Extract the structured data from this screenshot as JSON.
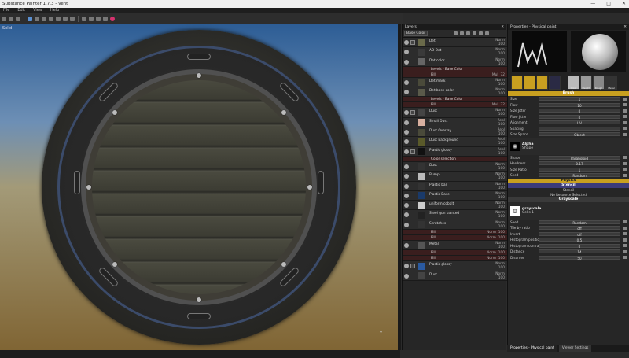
{
  "title": "Substance Painter 1.7.3 - Vent",
  "window_buttons": [
    "—",
    "□",
    "✕"
  ],
  "menu": [
    "File",
    "Edit",
    "View",
    "Help"
  ],
  "viewport": {
    "label": "Solid",
    "axis": "Y"
  },
  "layers": {
    "header": "Layers",
    "channel": "Base Color",
    "rows": [
      {
        "name": "Det",
        "blend": "Norm",
        "opacity": "100",
        "type": "group"
      },
      {
        "name": "AO Det",
        "blend": "Norm",
        "opacity": "100",
        "type": "layer"
      },
      {
        "name": "Det color",
        "blend": "Norm",
        "opacity": "100",
        "type": "layer"
      },
      {
        "name": "Levels - Base Color",
        "blend": "",
        "opacity": "",
        "type": "fx"
      },
      {
        "name": "Fill",
        "blend": "Mul",
        "opacity": "72",
        "type": "fx"
      },
      {
        "name": "Det mask",
        "blend": "Norm",
        "opacity": "100",
        "type": "layer"
      },
      {
        "name": "Det base color",
        "blend": "Norm",
        "opacity": "100",
        "type": "layer"
      },
      {
        "name": "Levels - Base Color",
        "blend": "",
        "opacity": "",
        "type": "fx"
      },
      {
        "name": "Fill",
        "blend": "Mul",
        "opacity": "72",
        "type": "fx"
      },
      {
        "name": "Dust",
        "blend": "Norm",
        "opacity": "100",
        "type": "group"
      },
      {
        "name": "Small Dust",
        "blend": "Repl",
        "opacity": "100",
        "type": "layer"
      },
      {
        "name": "Dust Overlay",
        "blend": "Repl",
        "opacity": "100",
        "type": "layer"
      },
      {
        "name": "Dust Background",
        "blend": "Repl",
        "opacity": "100",
        "type": "layer"
      },
      {
        "name": "Plastic glossy",
        "blend": "Repl",
        "opacity": "100",
        "type": "group"
      },
      {
        "name": "Color selection",
        "blend": "",
        "opacity": "",
        "type": "fx"
      },
      {
        "name": "Dust",
        "blend": "Norm",
        "opacity": "100",
        "type": "layer"
      },
      {
        "name": "Bump",
        "blend": "Norm",
        "opacity": "100",
        "type": "layer"
      },
      {
        "name": "Plastic bar",
        "blend": "Norm",
        "opacity": "100",
        "type": "layer"
      },
      {
        "name": "Plastic Base",
        "blend": "Norm",
        "opacity": "100",
        "type": "layer"
      },
      {
        "name": "uniform cobalt",
        "blend": "Norm",
        "opacity": "100",
        "type": "layer"
      },
      {
        "name": "Steel gun painted",
        "blend": "Norm",
        "opacity": "100",
        "type": "layer"
      },
      {
        "name": "Scratches",
        "blend": "Norm",
        "opacity": "100",
        "type": "layer"
      },
      {
        "name": "Fill",
        "blend": "Norm",
        "opacity": "100",
        "type": "fx"
      },
      {
        "name": "Fill",
        "blend": "Norm",
        "opacity": "100",
        "type": "fx"
      },
      {
        "name": "Metal",
        "blend": "Norm",
        "opacity": "100",
        "type": "layer"
      },
      {
        "name": "Fill",
        "blend": "Norm",
        "opacity": "100",
        "type": "fx"
      },
      {
        "name": "Fill",
        "blend": "Norm",
        "opacity": "100",
        "type": "fx"
      },
      {
        "name": "Plastic glossy",
        "blend": "Norm",
        "opacity": "100",
        "type": "group"
      },
      {
        "name": "Dust",
        "blend": "Norm",
        "opacity": "100",
        "type": "layer"
      }
    ]
  },
  "properties": {
    "header": "Properties - Physical paint",
    "channels": [
      "Color",
      "Height",
      "Rough",
      "Metal"
    ],
    "brush_title": "Brush",
    "brush": [
      {
        "label": "Size",
        "value": "1"
      },
      {
        "label": "Flow",
        "value": "10"
      },
      {
        "label": "Size Jitter",
        "value": "0"
      },
      {
        "label": "Flow Jitter",
        "value": "0"
      },
      {
        "label": "Alignment",
        "value": "UV"
      },
      {
        "label": "Spacing",
        "value": ""
      },
      {
        "label": "Size Space",
        "value": "Object"
      }
    ],
    "alpha": {
      "name": "Alpha",
      "sub": "Shape"
    },
    "shape": [
      {
        "label": "Shape",
        "value": "Paraboloid"
      },
      {
        "label": "Hardness",
        "value": "0.17"
      },
      {
        "label": "Size Ratio",
        "value": "1"
      },
      {
        "label": "Seed",
        "value": "Random"
      }
    ],
    "physics_title": "Physics",
    "stencil_title": "Stencil",
    "stencil_sub": "Stencil",
    "stencil_none": "No Resource Selected",
    "gray_title": "Grayscale",
    "gray_item": {
      "name": "grayscale",
      "sub": "Cells 1"
    },
    "gray": [
      {
        "label": "Seed",
        "value": "Random"
      },
      {
        "label": "Tile by ratio",
        "value": "off"
      },
      {
        "label": "Invert",
        "value": "off"
      },
      {
        "label": "Histogram position",
        "value": "0.5"
      },
      {
        "label": "Histogram contrast",
        "value": "0"
      },
      {
        "label": "Distance",
        "value": "14"
      },
      {
        "label": "Disorder",
        "value": "50"
      }
    ]
  },
  "bottom_tabs": [
    "Properties - Physical paint",
    "Viewer Settings"
  ]
}
